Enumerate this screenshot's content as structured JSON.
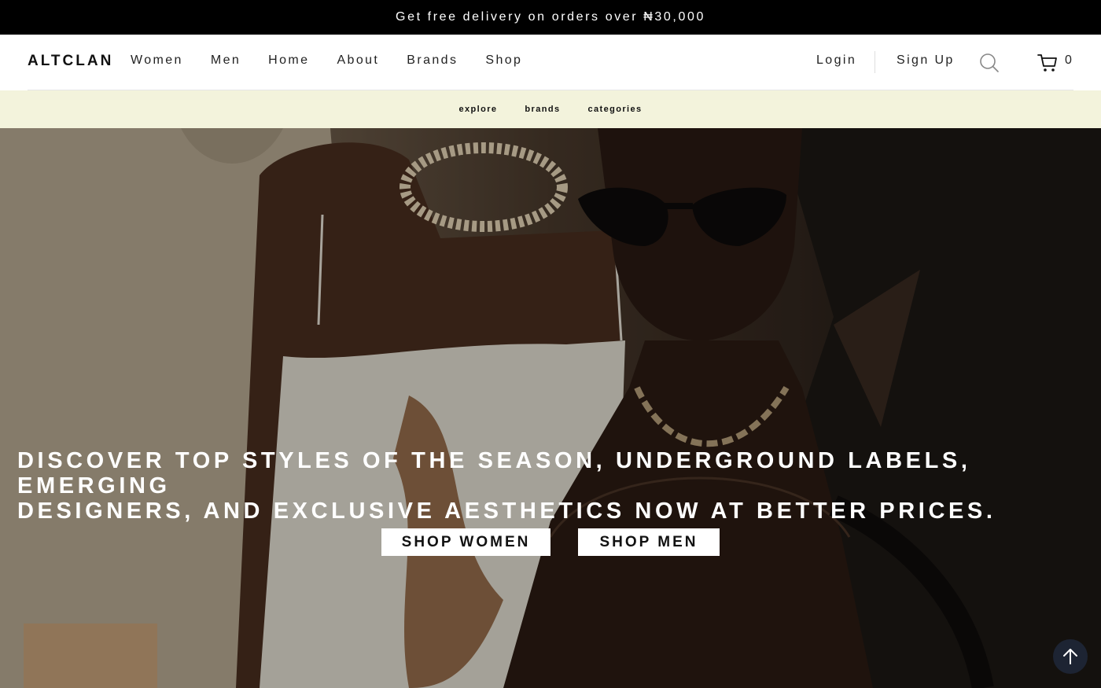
{
  "promo": {
    "text": "Get free delivery on orders over ₦30,000"
  },
  "header": {
    "logo": "ALTCLAN",
    "nav": [
      "Women",
      "Men",
      "Home",
      "About",
      "Brands",
      "Shop"
    ],
    "login": "Login",
    "signup": "Sign Up",
    "cart_count": "0"
  },
  "subnav": [
    "explore",
    "brands",
    "categories"
  ],
  "hero": {
    "headline_line1": "DISCOVER TOP STYLES OF THE SEASON, UNDERGROUND LABELS, EMERGING",
    "headline_line2": "DESIGNERS, AND EXCLUSIVE AESTHETICS NOW AT BETTER PRICES.",
    "shop_women": "SHOP WOMEN",
    "shop_men": "SHOP MEN"
  },
  "icons": {
    "search": "search-icon",
    "cart": "cart-icon",
    "scroll_top": "arrow-up-icon"
  },
  "colors": {
    "promo_bg": "#000000",
    "subnav_bg": "#f3f3dc",
    "scroll_top_bg": "#1d2433"
  }
}
